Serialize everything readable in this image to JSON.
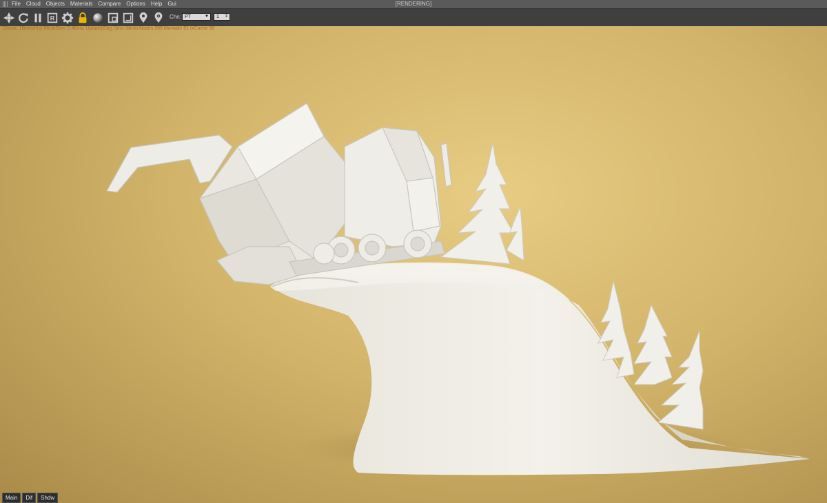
{
  "window": {
    "title": "[RENDERING]"
  },
  "menu": [
    "File",
    "Cloud",
    "Objects",
    "Materials",
    "Compare",
    "Options",
    "Help",
    "Gui"
  ],
  "toolbar": {
    "icons": [
      "aperture-icon",
      "refresh-icon",
      "pause-icon",
      "region-render-icon",
      "settings-gear-icon",
      "lock-icon",
      "sphere-material-icon",
      "copy-render-icon",
      "crop-region-icon",
      "pin-pick-icon",
      "pin-focus-icon"
    ],
    "channel_label": "Chn:",
    "channel_value": "PT",
    "pass_value": "1",
    "accent": "#f0b400"
  },
  "status": {
    "text": "Check: 1Bmesh(s) MeshGen: 5.46ms; Update[Obj]: 0ms; Mesh:Nodes 209 Movable 61 txCache 80"
  },
  "bottom_tabs": [
    "Main",
    "Dif",
    "Shdw"
  ],
  "colors": {
    "background": "#d2b46a",
    "model": "#f0eee7",
    "toolbar": "#3f3f3f"
  }
}
